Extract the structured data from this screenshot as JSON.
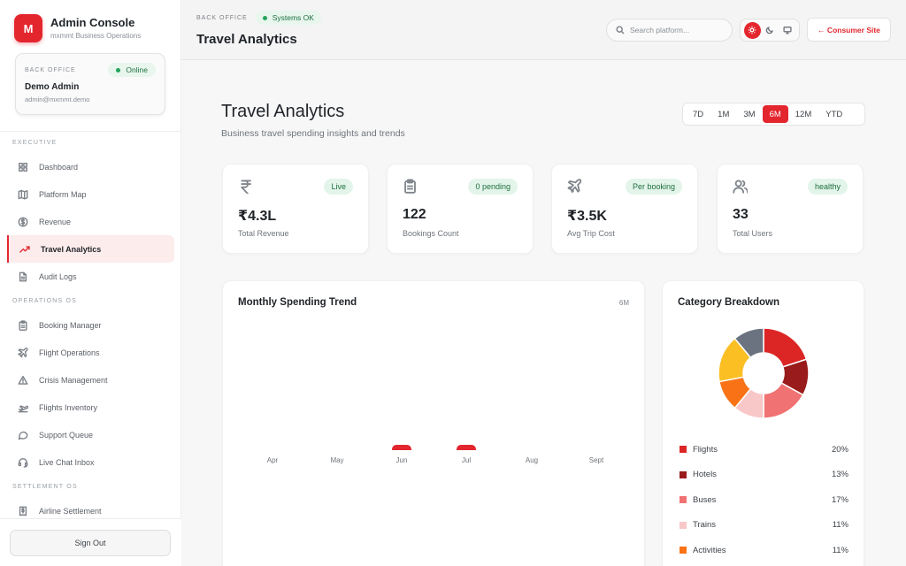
{
  "brand": {
    "logo": "M",
    "title": "Admin Console",
    "subtitle": "mxmmt Business Operations"
  },
  "user": {
    "label": "BACK OFFICE",
    "status": "Online",
    "name": "Demo Admin",
    "email": "admin@mxmmt.demo"
  },
  "nav": {
    "sections": [
      {
        "title": "EXECUTIVE",
        "items": [
          {
            "label": "Dashboard",
            "icon": "grid-icon"
          },
          {
            "label": "Platform Map",
            "icon": "map-icon"
          },
          {
            "label": "Revenue",
            "icon": "dollar-icon"
          },
          {
            "label": "Travel Analytics",
            "icon": "trending-up-icon",
            "active": true
          },
          {
            "label": "Audit Logs",
            "icon": "file-icon"
          }
        ]
      },
      {
        "title": "OPERATIONS OS",
        "items": [
          {
            "label": "Booking Manager",
            "icon": "clipboard-icon"
          },
          {
            "label": "Flight Operations",
            "icon": "plane-icon"
          },
          {
            "label": "Crisis Management",
            "icon": "alert-icon"
          },
          {
            "label": "Flights Inventory",
            "icon": "plane-takeoff-icon"
          },
          {
            "label": "Support Queue",
            "icon": "chat-icon"
          },
          {
            "label": "Live Chat Inbox",
            "icon": "headset-icon"
          }
        ]
      },
      {
        "title": "SETTLEMENT OS",
        "items": [
          {
            "label": "Airline Settlement",
            "icon": "receipt-icon"
          }
        ]
      }
    ],
    "signout": "Sign Out"
  },
  "header": {
    "crumb": "BACK OFFICE",
    "status": "Systems OK",
    "title": "Travel Analytics",
    "search_placeholder": "Search platform...",
    "consumer_link": "← Consumer Site"
  },
  "page": {
    "title": "Travel Analytics",
    "subtitle": "Business travel spending insights and trends",
    "ranges": [
      "7D",
      "1M",
      "3M",
      "6M",
      "12M",
      "YTD"
    ],
    "active_range": "6M"
  },
  "stats": [
    {
      "icon": "rupee-icon",
      "badge": "Live",
      "value": "₹4.3L",
      "label": "Total Revenue"
    },
    {
      "icon": "clipboard-icon",
      "badge": "0 pending",
      "value": "122",
      "label": "Bookings Count"
    },
    {
      "icon": "plane-icon",
      "badge": "Per booking",
      "value": "₹3.5K",
      "label": "Avg Trip Cost"
    },
    {
      "icon": "users-icon",
      "badge": "healthy",
      "value": "33",
      "label": "Total Users"
    }
  ],
  "trend": {
    "title": "Monthly Spending Trend",
    "range_tag": "6M",
    "months": [
      "Apr",
      "May",
      "Jun",
      "Jul",
      "Aug",
      "Sept"
    ],
    "values": [
      0,
      0,
      1,
      1,
      0,
      0
    ]
  },
  "breakdown": {
    "title": "Category Breakdown",
    "items": [
      {
        "name": "Flights",
        "pct": "20%",
        "value": 20,
        "color": "#dc2626"
      },
      {
        "name": "Hotels",
        "pct": "13%",
        "value": 13,
        "color": "#991b1b"
      },
      {
        "name": "Buses",
        "pct": "17%",
        "value": 17,
        "color": "#f07272"
      },
      {
        "name": "Trains",
        "pct": "11%",
        "value": 11,
        "color": "#f8c7c7"
      },
      {
        "name": "Activities",
        "pct": "11%",
        "value": 11,
        "color": "#f97316"
      }
    ],
    "unlisted_segments": [
      {
        "value": 17,
        "color": "#fbbf24"
      },
      {
        "value": 11,
        "color": "#6b7280"
      }
    ]
  }
}
